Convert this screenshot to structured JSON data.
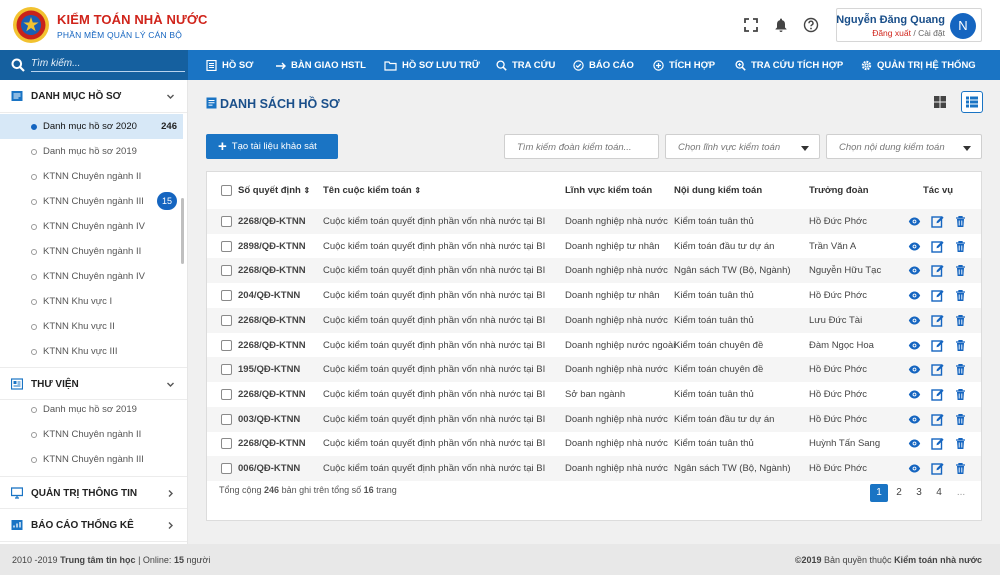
{
  "brand": {
    "title": "KIỂM TOÁN NHÀ NƯỚC",
    "subtitle": "PHẦN MỀM QUẢN LÝ CÁN BỘ"
  },
  "user": {
    "name": "Nguyễn Đăng Quang",
    "logout": "Đăng xuất",
    "separator": "/",
    "settings": "Cài đặt",
    "avatar_letter": "N"
  },
  "search": {
    "placeholder": "Tìm kiếm..."
  },
  "nav": [
    "HỒ SƠ",
    "BÀN GIAO HSTL",
    "HỒ SƠ LƯU TRỮ",
    "TRA CỨU",
    "BÁO CÁO",
    "TÍCH HỢP",
    "TRA CỨU TÍCH HỢP",
    "QUẢN TRỊ HỆ THỐNG"
  ],
  "sidebar": {
    "catalog_title": "DANH MỤC HỒ SƠ",
    "catalog_items": [
      {
        "label": "Danh mục hồ sơ 2020",
        "count": "246"
      },
      {
        "label": "Danh mục hồ sơ 2019"
      },
      {
        "label": "KTNN Chuyên ngành II"
      },
      {
        "label": "KTNN Chuyên ngành III",
        "badge": "15"
      },
      {
        "label": "KTNN Chuyên ngành IV"
      },
      {
        "label": "KTNN Chuyên ngành II"
      },
      {
        "label": "KTNN Chuyên ngành IV"
      },
      {
        "label": "KTNN Khu vực I"
      },
      {
        "label": "KTNN Khu vực II"
      },
      {
        "label": "KTNN Khu vực III"
      }
    ],
    "library_title": "THƯ VIỆN",
    "library_items": [
      {
        "label": "Danh mục hồ sơ 2019"
      },
      {
        "label": "KTNN Chuyên ngành II"
      },
      {
        "label": "KTNN Chuyên ngành III"
      }
    ],
    "admin_title": "QUẢN TRỊ THÔNG TIN",
    "report_title": "BÁO CÁO THỐNG KÊ"
  },
  "main": {
    "title": "DANH SÁCH HỒ SƠ",
    "create_label": "Tạo tài liệu khảo sát",
    "search_audit_placeholder": "Tìm kiếm đoàn kiểm toán...",
    "field_select": "Chọn lĩnh vực kiểm toán",
    "content_select": "Chọn nội dung kiểm toán"
  },
  "table": {
    "headers": [
      "Số quyết định",
      "Tên cuộc kiểm toán",
      "Lĩnh vực kiểm toán",
      "Nội dung kiểm toán",
      "Trưởng đoàn",
      "Tác vụ"
    ],
    "rows": [
      [
        "2268/QĐ-KTNN",
        "Cuộc kiểm toán quyết định phần vốn nhà nước tại BIC...",
        "Doanh nghiệp nhà nước",
        "Kiểm toán tuân thủ",
        "Hồ Đức Phớc"
      ],
      [
        "2898/QĐ-KTNN",
        "Cuộc kiểm toán quyết định phần vốn nhà nước tại BIC...",
        "Doanh nghiệp tư nhân",
        "Kiểm toán đầu tư dự án",
        "Trần Văn A"
      ],
      [
        "2268/QĐ-KTNN",
        "Cuộc kiểm toán quyết định phần vốn nhà nước tại BIC...",
        "Doanh nghiệp nhà nước",
        "Ngân sách TW (Bộ, Ngành)",
        "Nguyễn Hữu Tạc"
      ],
      [
        "204/QĐ-KTNN",
        "Cuộc kiểm toán quyết định phần vốn nhà nước tại BIC...",
        "Doanh nghiệp tư nhân",
        "Kiểm toán tuân thủ",
        "Hồ Đức Phớc"
      ],
      [
        "2268/QĐ-KTNN",
        "Cuộc kiểm toán quyết định phần vốn nhà nước tại BIC...",
        "Doanh nghiệp nhà nước",
        "Kiểm toán tuân thủ",
        "Lưu Đức Tài"
      ],
      [
        "2268/QĐ-KTNN",
        "Cuộc kiểm toán quyết định phần vốn nhà nước tại BIC...",
        "Doanh nghiệp nước ngoài",
        "Kiểm toán chuyên đề",
        "Đàm Ngọc Hoa"
      ],
      [
        "195/QĐ-KTNN",
        "Cuộc kiểm toán quyết định phần vốn nhà nước tại BIC...",
        "Doanh nghiệp nhà nước",
        "Kiểm toán chuyên đề",
        "Hồ Đức Phớc"
      ],
      [
        "2268/QĐ-KTNN",
        "Cuộc kiểm toán quyết định phần vốn nhà nước tại BIC...",
        "Sở ban ngành",
        "Kiểm toán tuân thủ",
        "Hồ Đức Phớc"
      ],
      [
        "003/QĐ-KTNN",
        "Cuộc kiểm toán quyết định phần vốn nhà nước tại BIC...",
        "Doanh nghiệp nhà nước",
        "Kiểm toán đầu tư dự án",
        "Hồ Đức Phớc"
      ],
      [
        "2268/QĐ-KTNN",
        "Cuộc kiểm toán quyết định phần vốn nhà nước tại BIC...",
        "Doanh nghiệp nhà nước",
        "Kiểm toán tuân thủ",
        "Huỳnh Tấn Sang"
      ],
      [
        "006/QĐ-KTNN",
        "Cuộc kiểm toán quyết định phần vốn nhà nước tại BIC...",
        "Doanh nghiệp nhà nước",
        "Ngân sách TW (Bộ, Ngành)",
        "Hồ Đức Phớc"
      ]
    ],
    "summary": {
      "prefix": "Tổng cộng",
      "total": "246",
      "middle": "bản ghi trên tổng số",
      "pages": "16",
      "suffix": "trang"
    },
    "pagination": [
      "1",
      "2",
      "3",
      "4",
      "..."
    ]
  },
  "footer": {
    "years": "2010 -2019",
    "center": "Trung tâm tin học",
    "online_label": "| Online:",
    "online_count": "15",
    "online_unit": "người",
    "copyright": "©2019",
    "rights": "Bản quyền thuộc",
    "org": "Kiểm toán nhà nước"
  },
  "colors": {
    "primary": "#1a74c4",
    "dark": "#15609f",
    "brand_red": "#d0241b",
    "accent_blue": "#1565c0"
  }
}
